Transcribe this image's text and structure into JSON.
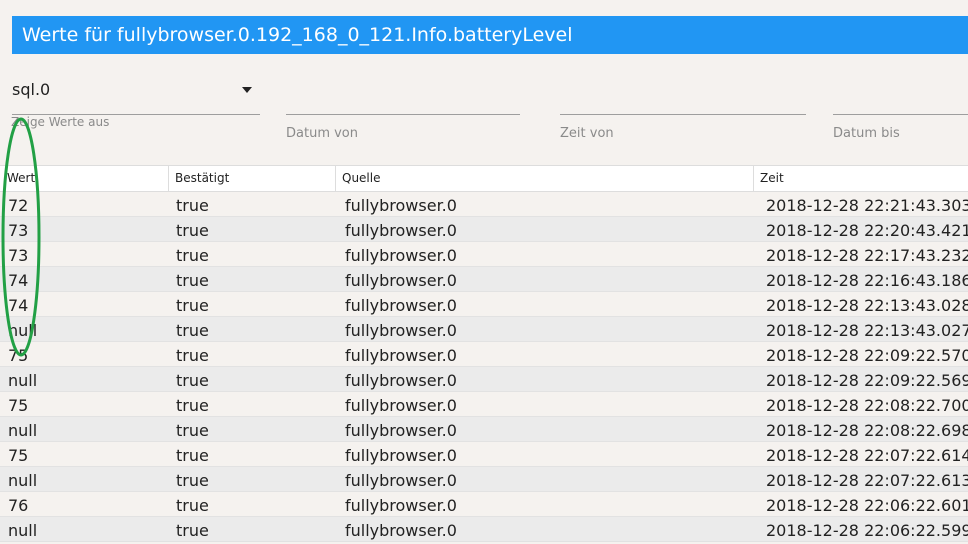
{
  "window": {
    "title": "Werte für fullybrowser.0.192_168_0_121.Info.batteryLevel"
  },
  "filters": {
    "instance_value": "sql.0",
    "instance_helper": "Zeige Werte aus",
    "date_from_label": "Datum von",
    "time_from_label": "Zeit von",
    "date_to_label": "Datum bis"
  },
  "table": {
    "headers": [
      "Wert",
      "Bestätigt",
      "Quelle",
      "Zeit"
    ],
    "rows": [
      {
        "wert": "72",
        "bestaetigt": "true",
        "quelle": "fullybrowser.0",
        "zeit": "2018-12-28 22:21:43.303"
      },
      {
        "wert": "73",
        "bestaetigt": "true",
        "quelle": "fullybrowser.0",
        "zeit": "2018-12-28 22:20:43.421"
      },
      {
        "wert": "73",
        "bestaetigt": "true",
        "quelle": "fullybrowser.0",
        "zeit": "2018-12-28 22:17:43.232"
      },
      {
        "wert": "74",
        "bestaetigt": "true",
        "quelle": "fullybrowser.0",
        "zeit": "2018-12-28 22:16:43.186"
      },
      {
        "wert": "74",
        "bestaetigt": "true",
        "quelle": "fullybrowser.0",
        "zeit": "2018-12-28 22:13:43.028"
      },
      {
        "wert": "null",
        "bestaetigt": "true",
        "quelle": "fullybrowser.0",
        "zeit": "2018-12-28 22:13:43.027"
      },
      {
        "wert": "75",
        "bestaetigt": "true",
        "quelle": "fullybrowser.0",
        "zeit": "2018-12-28 22:09:22.570"
      },
      {
        "wert": "null",
        "bestaetigt": "true",
        "quelle": "fullybrowser.0",
        "zeit": "2018-12-28 22:09:22.569"
      },
      {
        "wert": "75",
        "bestaetigt": "true",
        "quelle": "fullybrowser.0",
        "zeit": "2018-12-28 22:08:22.700"
      },
      {
        "wert": "null",
        "bestaetigt": "true",
        "quelle": "fullybrowser.0",
        "zeit": "2018-12-28 22:08:22.698"
      },
      {
        "wert": "75",
        "bestaetigt": "true",
        "quelle": "fullybrowser.0",
        "zeit": "2018-12-28 22:07:22.614"
      },
      {
        "wert": "null",
        "bestaetigt": "true",
        "quelle": "fullybrowser.0",
        "zeit": "2018-12-28 22:07:22.613"
      },
      {
        "wert": "76",
        "bestaetigt": "true",
        "quelle": "fullybrowser.0",
        "zeit": "2018-12-28 22:06:22.601"
      },
      {
        "wert": "null",
        "bestaetigt": "true",
        "quelle": "fullybrowser.0",
        "zeit": "2018-12-28 22:06:22.599"
      }
    ]
  },
  "colors": {
    "title_bar": "#2196f3",
    "annotation_ellipse": "#22a045"
  }
}
